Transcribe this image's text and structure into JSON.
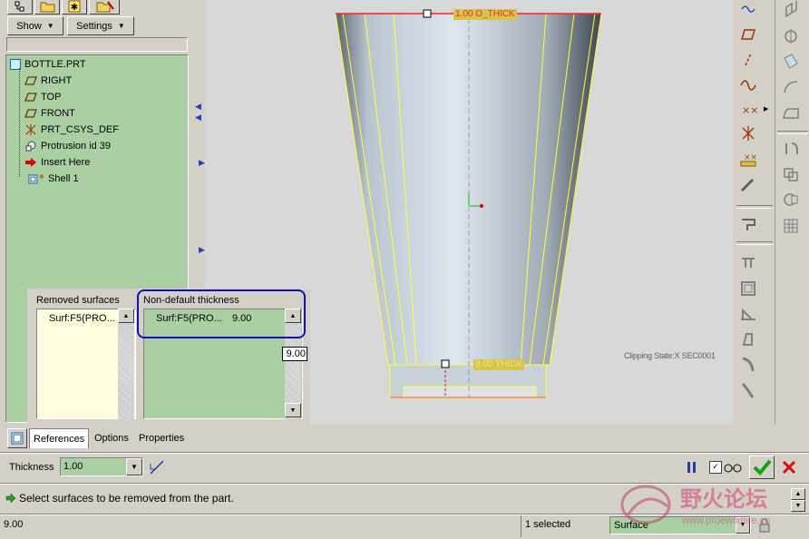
{
  "tree_toolbar": {
    "show_label": "Show",
    "settings_label": "Settings"
  },
  "model_tree": {
    "root": "BOTTLE.PRT",
    "items": [
      {
        "label": "RIGHT",
        "icon": "datum-plane-icon"
      },
      {
        "label": "TOP",
        "icon": "datum-plane-icon"
      },
      {
        "label": "FRONT",
        "icon": "datum-plane-icon"
      },
      {
        "label": "PRT_CSYS_DEF",
        "icon": "csys-icon"
      },
      {
        "label": "Protrusion id 39",
        "icon": "protrusion-icon"
      },
      {
        "label": "Insert Here",
        "icon": "insert-arrow-icon"
      },
      {
        "label": "Shell 1",
        "icon": "shell-icon"
      }
    ]
  },
  "panels": {
    "removed_title": "Removed surfaces",
    "removed_item": "Surf:F5(PRO...",
    "nondefault_title": "Non-default thickness",
    "nondefault_item": "Surf:F5(PRO...",
    "nondefault_value": "9.00",
    "edit_value": "9.00"
  },
  "viewport": {
    "top_label": "1.00 O_THICK",
    "bottom_label": "9.00 THICK",
    "clip_label": "Clipping State:X SEC0001",
    "colors": {
      "bg": "#d8d8d8",
      "edge": "#ffff00",
      "top_edge": "#ff2020"
    }
  },
  "dashboard": {
    "tabs": [
      "References",
      "Options",
      "Properties"
    ],
    "thickness_label": "Thickness",
    "thickness_value": "1.00"
  },
  "message": "Select surfaces to be removed from the part.",
  "status": {
    "value": "9.00",
    "selected": "1 selected",
    "filter": "Surface"
  },
  "watermark": {
    "title": "野火论坛",
    "url": "www.proewildfire.cn"
  }
}
